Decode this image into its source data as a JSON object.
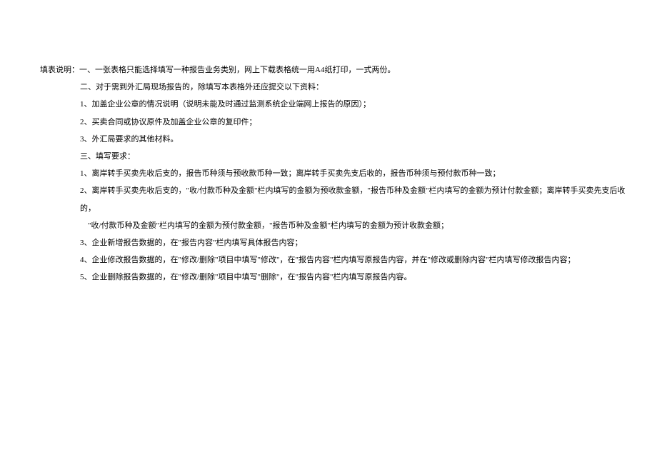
{
  "header_label": "填表说明：",
  "items": {
    "i1": "一、一张表格只能选择填写一种报告业务类别，网上下载表格统一用A4纸打印，一式两份。",
    "i2": "二、对于需到外汇局现场报告的，除填写本表格外还应提交以下资料：",
    "i2_1": "1、加盖企业公章的情况说明（说明未能及时通过监测系统企业端网上报告的原因）；",
    "i2_2": "2、买卖合同或协议原件及加盖企业公章的复印件；",
    "i2_3": "3、外汇局要求的其他材料。",
    "i3": "三、填写要求：",
    "i3_1": "1、离岸转手买卖先收后支的，报告币种须与预收款币种一致；离岸转手买卖先支后收的，报告币种须与预付款币种一致；",
    "i3_2a": "2、离岸转手买卖先收后支的，\"收/付款币种及金额\"栏内填写的金额为预收款金额，\"报告币种及金额\"栏内填写的金额为预计付款金额；离岸转手买卖先支后收的，",
    "i3_2b": "\"收/付款币种及金额\"栏内填写的金额为预付款金额，\"报告币种及金额\"栏内填写的金额为预计收款金额；",
    "i3_3": "3、企业新增报告数据的，在\"报告内容\"栏内填写具体报告内容；",
    "i3_4": "4、企业修改报告数据的，在\"修改/删除\"项目中填写\"修改\"，在\"报告内容\"栏内填写原报告内容，并在\"修改或删除内容\"栏内填写修改报告内容；",
    "i3_5": "5、企业删除报告数据的，在\"修改/删除\"项目中填写\"删除\"，在\"报告内容\"栏内填写原报告内容。"
  }
}
